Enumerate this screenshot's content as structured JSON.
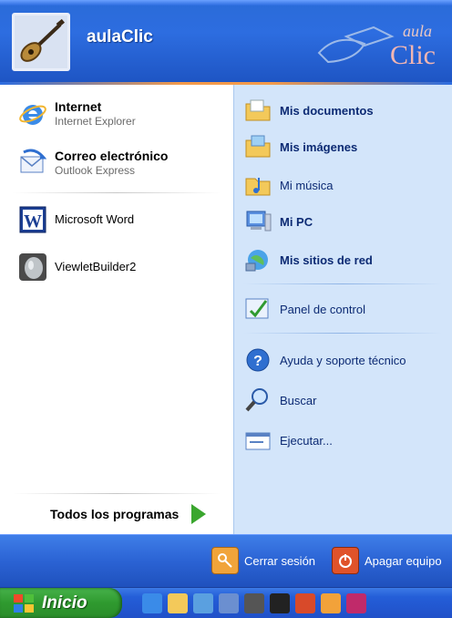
{
  "header": {
    "username": "aulaClic",
    "logo_small": "aula",
    "logo_big": "Clic"
  },
  "pinned": [
    {
      "title": "Internet",
      "subtitle": "Internet Explorer",
      "icon": "internet-explorer-icon"
    },
    {
      "title": "Correo electrónico",
      "subtitle": "Outlook Express",
      "icon": "outlook-express-icon"
    }
  ],
  "recent": [
    {
      "label": "Microsoft Word",
      "icon": "word-icon"
    },
    {
      "label": "ViewletBuilder2",
      "icon": "viewletbuilder-icon"
    }
  ],
  "all_programs": "Todos los programas",
  "right_menu": {
    "documents": "Mis documentos",
    "images": "Mis imágenes",
    "music": "Mi música",
    "pc": "Mi PC",
    "network": "Mis sitios de red",
    "control_panel": "Panel de control",
    "help": "Ayuda y soporte técnico",
    "search": "Buscar",
    "run": "Ejecutar..."
  },
  "bottom": {
    "logoff": "Cerrar sesión",
    "shutdown": "Apagar equipo"
  },
  "taskbar": {
    "start": "Inicio"
  },
  "colors": {
    "header_blue": "#2d6de0",
    "right_panel": "#d3e5fa",
    "start_green": "#3aa62e",
    "link_blue": "#0c2a73"
  }
}
